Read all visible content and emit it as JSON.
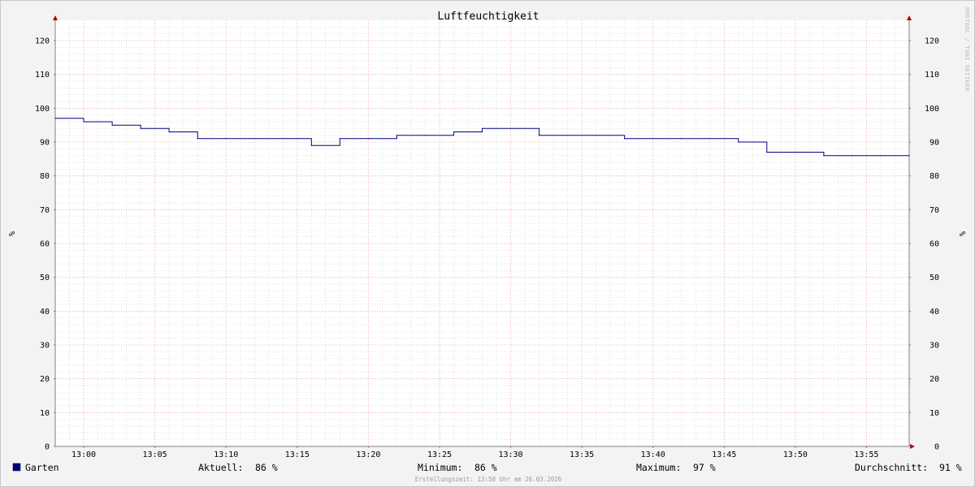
{
  "chart_data": {
    "type": "line",
    "title": "Luftfeuchtigkeit",
    "ylabel": "%",
    "ylabel_right": "%",
    "watermark": "RRDTOOL / TOBI OETIKER",
    "x_ticks": [
      "13:00",
      "13:05",
      "13:10",
      "13:15",
      "13:20",
      "13:25",
      "13:30",
      "13:35",
      "13:40",
      "13:45",
      "13:50",
      "13:55"
    ],
    "y_ticks": [
      0,
      10,
      20,
      30,
      40,
      50,
      60,
      70,
      80,
      90,
      100,
      110,
      120
    ],
    "ylim": [
      0,
      126
    ],
    "xlim": [
      "12:58",
      "13:58"
    ],
    "grid": true,
    "series": [
      {
        "name": "Garten",
        "color": "#000080",
        "x": [
          "12:58",
          "13:00",
          "13:02",
          "13:04",
          "13:06",
          "13:08",
          "13:10",
          "13:12",
          "13:14",
          "13:16",
          "13:18",
          "13:20",
          "13:22",
          "13:24",
          "13:26",
          "13:28",
          "13:30",
          "13:32",
          "13:34",
          "13:36",
          "13:38",
          "13:40",
          "13:42",
          "13:44",
          "13:46",
          "13:48",
          "13:50",
          "13:52",
          "13:54",
          "13:56",
          "13:58"
        ],
        "values": [
          97,
          96,
          95,
          94,
          93,
          91,
          91,
          91,
          91,
          89,
          91,
          91,
          92,
          92,
          93,
          94,
          94,
          92,
          92,
          92,
          91,
          91,
          91,
          91,
          90,
          87,
          87,
          86,
          86,
          86,
          86
        ]
      }
    ]
  },
  "legend": {
    "swatch_color": "#000080",
    "series_name": "Garten",
    "current_label": "Aktuell:",
    "current_value": "86 %",
    "min_label": "Minimum:",
    "min_value": "86 %",
    "max_label": "Maximum:",
    "max_value": "97 %",
    "avg_label": "Durchschnitt:",
    "avg_value": "91 %"
  },
  "footer": "Erstellungszeit: 13:58 Uhr am 26.03.2026",
  "colors": {
    "background": "#f3f3f3",
    "plot_background": "#ffffff",
    "major_grid": "#e8a0a0",
    "minor_grid": "#d8d8d8",
    "axis": "#808080",
    "arrow": "#aa0000"
  }
}
